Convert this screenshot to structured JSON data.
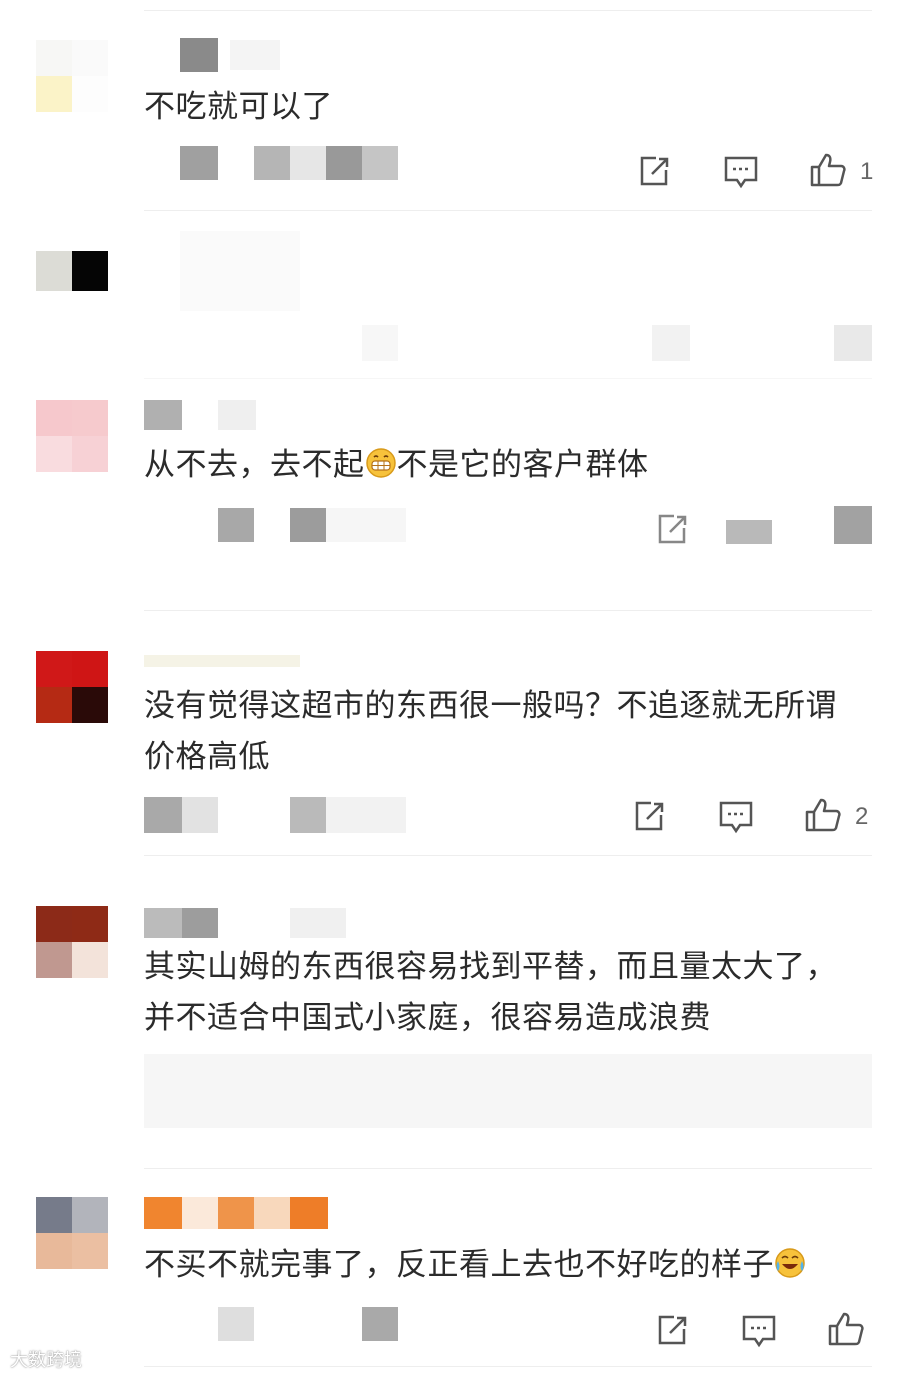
{
  "comments": [
    {
      "text": "不吃就可以了",
      "actions": {
        "share": "share-icon",
        "reply": "comment-icon",
        "like": "like-icon",
        "like_count": "1"
      }
    },
    {
      "text": ""
    },
    {
      "text": "从不去，去不起",
      "text_after_emoji": "不是它的客户群体",
      "emoji": "grin-emoji"
    },
    {
      "text": "没有觉得这超市的东西很一般吗？不追逐就无所谓价格高低",
      "actions": {
        "like_count": "2"
      }
    },
    {
      "text": "其实山姆的东西很容易找到平替，而且量太大了，并不适合中国式小家庭，很容易造成浪费"
    },
    {
      "text": "不买不就完事了，反正看上去也不好吃的样子",
      "emoji": "laugh-cry-emoji"
    }
  ],
  "watermark": "大数跨境",
  "colors": {
    "divider": "#eeeeee",
    "icon": "#555555",
    "blur_grey": "#9a9a9a",
    "orange": "#f08a3a"
  }
}
